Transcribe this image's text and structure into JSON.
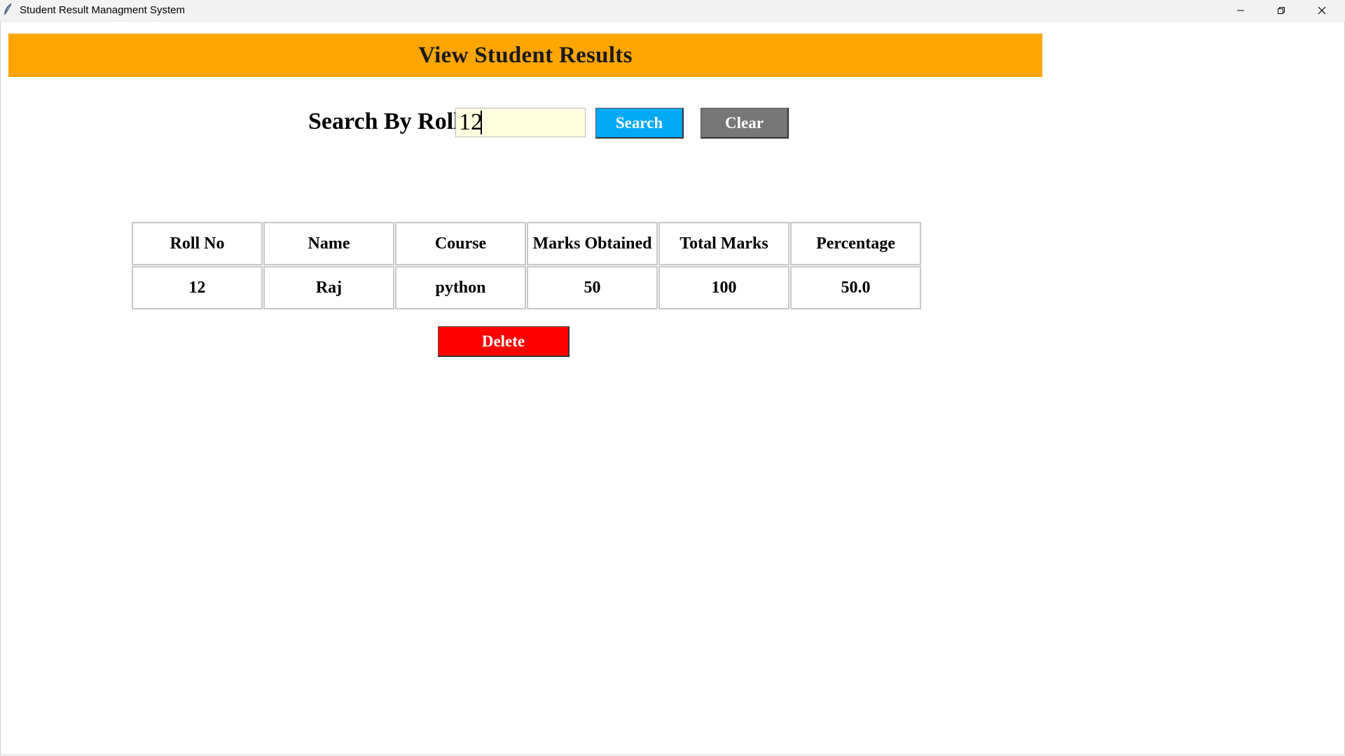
{
  "window": {
    "title": "Student Result Managment System",
    "icon": "feather-icon",
    "controls": [
      "minimize-icon",
      "restore-icon",
      "close-icon"
    ]
  },
  "header": {
    "title": "View Student Results",
    "background_color": "#ffa500"
  },
  "search": {
    "label": "Search By Roll",
    "value": "12",
    "input_background": "#ffffe0",
    "search_button": {
      "label": "Search",
      "color": "#03a9f4"
    },
    "clear_button": {
      "label": "Clear",
      "color": "#777777"
    }
  },
  "table": {
    "columns": [
      "Roll No",
      "Name",
      "Course",
      "Marks Obtained",
      "Total Marks",
      "Percentage"
    ],
    "rows": [
      [
        "12",
        "Raj",
        "python",
        "50",
        "100",
        "50.0"
      ]
    ]
  },
  "delete_button": {
    "label": "Delete",
    "color": "#ff0000"
  }
}
